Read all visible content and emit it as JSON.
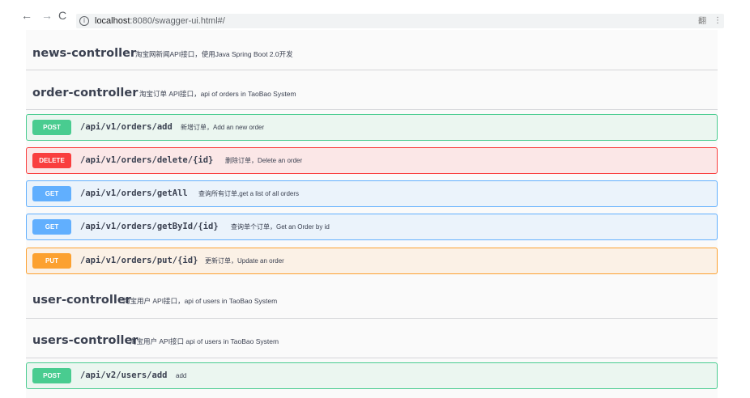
{
  "browser": {
    "back_icon": "←",
    "forward_icon": "→",
    "reload_icon": "C",
    "info_icon": "i",
    "url_host": "localhost",
    "url_rest": ":8080/swagger-ui.html#/",
    "extension_icon": "翻",
    "menu_icon": "⋮"
  },
  "tags": [
    {
      "name": "news-controller",
      "description": "淘宝网新闻API接口，使用Java Spring Boot 2.0开发"
    },
    {
      "name": "order-controller",
      "description": "淘宝订单 API接口，api of orders in TaoBao System"
    },
    {
      "name": "user-controller",
      "description": "淘宝用户 API接口，api of users in TaoBao System"
    },
    {
      "name": "users-controller",
      "description": "淘宝用户 API接口 api of users in TaoBao System"
    }
  ],
  "operations": [
    {
      "method": "POST",
      "path": "/api/v1/orders/add",
      "summary": "新增订单，Add an new order"
    },
    {
      "method": "DELETE",
      "path": "/api/v1/orders/delete/{id}",
      "summary": "删除订单，Delete an order"
    },
    {
      "method": "GET",
      "path": "/api/v1/orders/getAll",
      "summary": "查询所有订单,get a list of all orders"
    },
    {
      "method": "GET",
      "path": "/api/v1/orders/getById/{id}",
      "summary": "查询单个订单，Get an Order by id"
    },
    {
      "method": "PUT",
      "path": "/api/v1/orders/put/{id}",
      "summary": "更新订单，Update an order"
    },
    {
      "method": "POST",
      "path": "/api/v2/users/add",
      "summary": "add"
    }
  ],
  "colors": {
    "post": "#49cc90",
    "post_bg": "#ebf6f0",
    "delete": "#f93e3e",
    "delete_bg": "#fbe7e7",
    "get": "#61affe",
    "get_bg": "#ebf3fb",
    "put": "#fca130",
    "put_bg": "#fbf1e6"
  }
}
